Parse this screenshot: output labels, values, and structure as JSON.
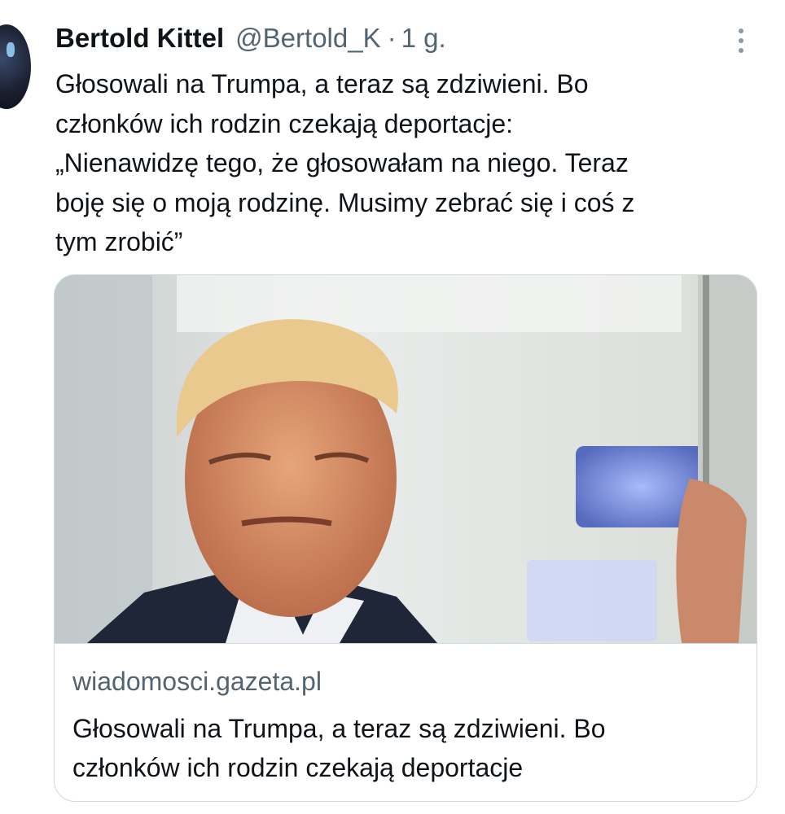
{
  "tweet": {
    "author_name": "Bertold Kittel",
    "author_handle": "@Bertold_K",
    "separator": "·",
    "timestamp": "1 g.",
    "avatar_icon": "profile-avatar",
    "more_icon": "vertical-dots-icon",
    "text": "Głosowali na Trumpa, a teraz są zdziwieni. Bo\nczłonków ich rodzin czekają deportacje:\n„Nienawidzę tego, że głosowałam na niego. Teraz\nboję się o moją rodzinę. Musimy zebrać się i coś z\ntym zrobić”"
  },
  "link_card": {
    "image_icon": "article-photo",
    "domain": "wiadomosci.gazeta.pl",
    "title": "Głosowali na Trumpa, a teraz są zdziwieni. Bo\nczłonków ich rodzin czekają deportacje"
  },
  "colors": {
    "text_primary": "#0f1419",
    "text_secondary": "#536471",
    "border": "#cfd9de",
    "background": "#ffffff"
  }
}
